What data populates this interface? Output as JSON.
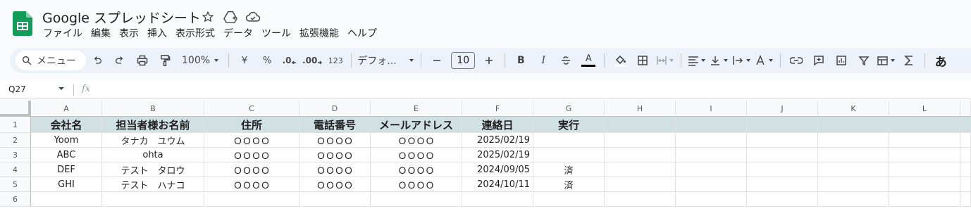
{
  "app": {
    "title": "Google スプレッドシート",
    "menu": [
      "ファイル",
      "編集",
      "表示",
      "挿入",
      "表示形式",
      "データ",
      "ツール",
      "拡張機能",
      "ヘルプ"
    ]
  },
  "toolbar": {
    "search_label": "メニュー",
    "zoom": "100%",
    "currency": "¥",
    "percent": "%",
    "dec_decrease": ".0",
    "dec_increase": ".00",
    "number_format": "123",
    "font": "デフォ...",
    "font_size": "10",
    "bold": "B",
    "italic": "I",
    "text_color": "A",
    "font_hira": "あ"
  },
  "formula_bar": {
    "name_box": "Q27",
    "fx": "fx"
  },
  "grid": {
    "columns": [
      "A",
      "B",
      "C",
      "D",
      "E",
      "F",
      "G",
      "H",
      "I",
      "J",
      "K",
      "L"
    ],
    "row_numbers": [
      "1",
      "2",
      "3",
      "4",
      "5",
      "6"
    ],
    "header": [
      "会社名",
      "担当者様お名前",
      "住所",
      "電話番号",
      "メールアドレス",
      "連絡日",
      "実行"
    ],
    "rows": [
      [
        "Yoom",
        "タナカ　ユウム",
        "ＯＯＯＯ",
        "ＯＯＯＯ",
        "ＯＯＯＯ",
        "2025/02/19",
        ""
      ],
      [
        "ABC",
        "ohta",
        "ＯＯＯＯ",
        "ＯＯＯＯ",
        "ＯＯＯＯ",
        "2025/02/19",
        ""
      ],
      [
        "DEF",
        "テスト　タロウ",
        "ＯＯＯＯ",
        "ＯＯＯＯ",
        "ＯＯＯＯ",
        "2024/09/05",
        "済"
      ],
      [
        "GHI",
        "テスト　ハナコ",
        "ＯＯＯＯ",
        "ＯＯＯＯ",
        "ＯＯＯＯ",
        "2024/10/11",
        "済"
      ],
      [
        "",
        "",
        "",
        "",
        "",
        "",
        ""
      ]
    ]
  },
  "colors": {
    "header_fill": "#d0e0e3",
    "logo_green": "#0f9d58"
  }
}
